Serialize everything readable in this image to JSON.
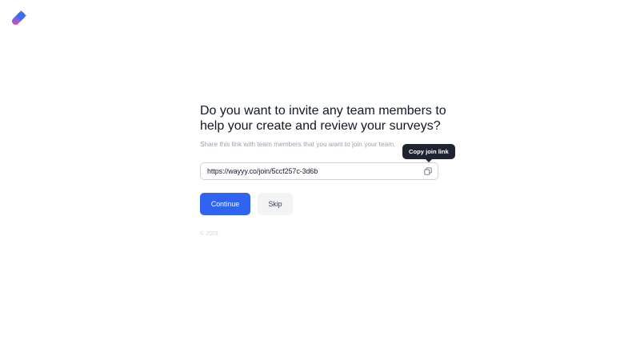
{
  "app": {
    "logo_icon": "brand-logo-pill-icon",
    "brand_colors": [
      "#3b6df0",
      "#ef4f86"
    ]
  },
  "invite": {
    "heading": "Do you want to invite any team members to help your create and review your surveys?",
    "subtext": "Share this link with team members that you want to join your team.",
    "join_link": "https://wayyy.co/join/5ccf257c-3d6b",
    "copy_icon": "copy-icon",
    "tooltip": "Copy join link"
  },
  "actions": {
    "continue_label": "Continue",
    "skip_label": "Skip",
    "accent_color": "#2f63f0"
  },
  "footer": {
    "copyright": "© 2023"
  }
}
